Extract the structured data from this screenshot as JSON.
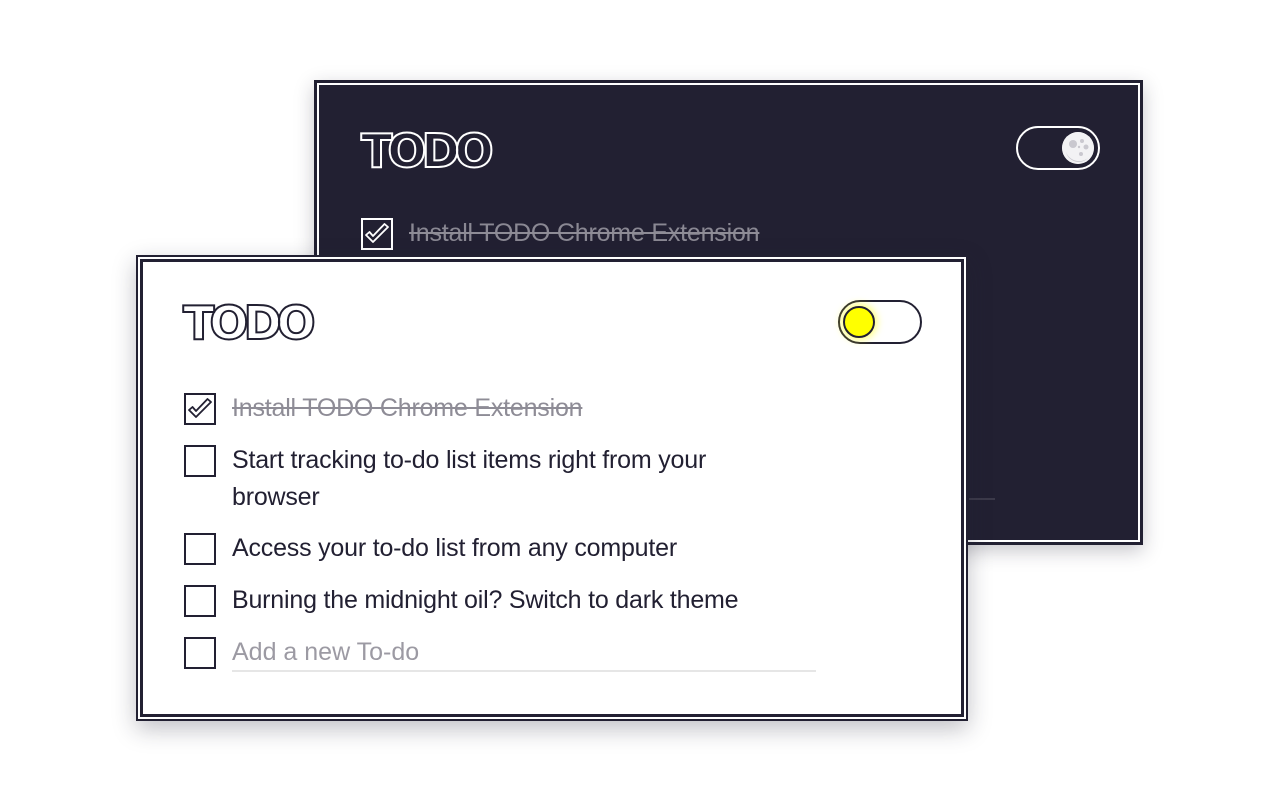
{
  "colors": {
    "ink": "#222032",
    "paper": "#ffffff",
    "sun": "#ffff00",
    "muted": "#8e8c96",
    "underline": "#e6e6e6"
  },
  "dark_card": {
    "theme": "dark",
    "logo": "TODO",
    "toggle": {
      "state": "dark",
      "icon": "moon-icon"
    },
    "items": [
      {
        "label": "Install TODO Chrome Extension",
        "done": true
      }
    ]
  },
  "light_card": {
    "theme": "light",
    "logo": "TODO",
    "toggle": {
      "state": "light",
      "icon": "sun-icon"
    },
    "items": [
      {
        "label": "Install TODO Chrome Extension",
        "done": true
      },
      {
        "label": "Start tracking to-do list items right from your browser",
        "done": false
      },
      {
        "label": "Access your to-do list from any computer",
        "done": false
      },
      {
        "label": "Burning the midnight oil? Switch to dark theme",
        "done": false
      }
    ],
    "new_todo": {
      "placeholder": "Add a new To-do",
      "value": ""
    }
  }
}
